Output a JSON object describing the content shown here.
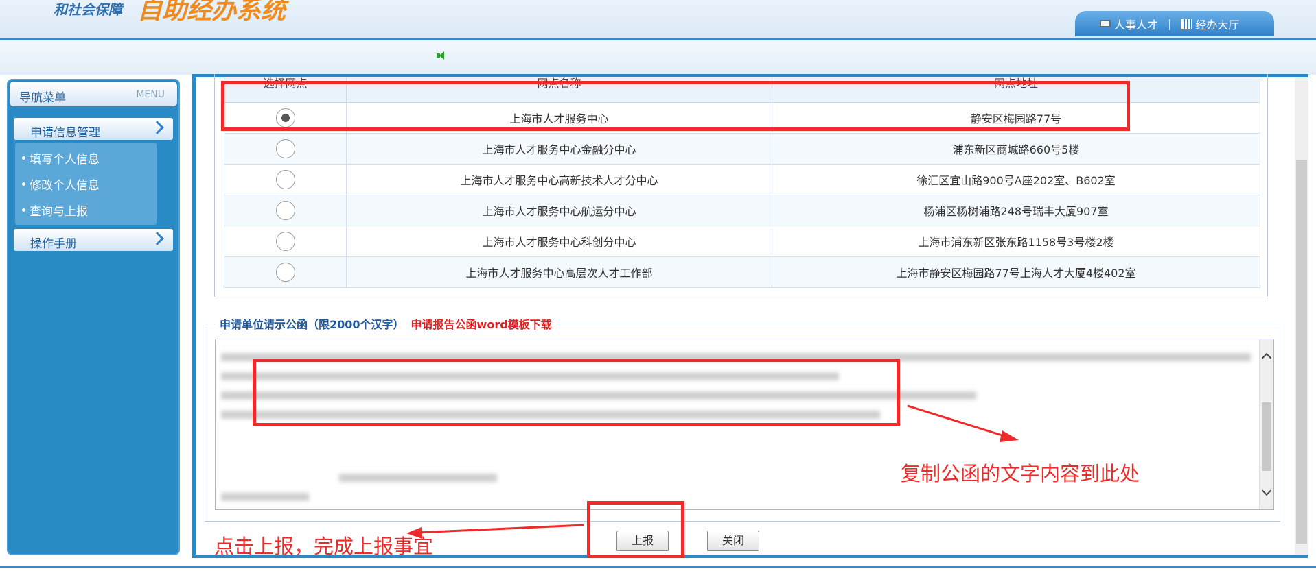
{
  "header": {
    "logo_sub": "和社会保障",
    "logo_main": "自助经办系统",
    "tabs": [
      {
        "label": "人事人才",
        "icon": "monitor-icon"
      },
      {
        "label": "经办大厅",
        "icon": "building-icon"
      }
    ],
    "tab_separator": "|"
  },
  "sidebar": {
    "title": "导航菜单",
    "title_en": "MENU",
    "groups": [
      {
        "label": "申请信息管理"
      },
      {
        "label": "操作手册"
      }
    ],
    "items": [
      {
        "label": "填写个人信息"
      },
      {
        "label": "修改个人信息"
      },
      {
        "label": "查询与上报"
      }
    ]
  },
  "table": {
    "headers": [
      "选择网点",
      "网点名称",
      "网点地址"
    ],
    "rows": [
      {
        "selected": true,
        "name": "上海市人才服务中心",
        "address": "静安区梅园路77号"
      },
      {
        "selected": false,
        "name": "上海市人才服务中心金融分中心",
        "address": "浦东新区商城路660号5楼"
      },
      {
        "selected": false,
        "name": "上海市人才服务中心高新技术人才分中心",
        "address": "徐汇区宜山路900号A座202室、B602室"
      },
      {
        "selected": false,
        "name": "上海市人才服务中心航运分中心",
        "address": "杨浦区杨树浦路248号瑞丰大厦907室"
      },
      {
        "selected": false,
        "name": "上海市人才服务中心科创分中心",
        "address": "上海市浦东新区张东路1158号3号楼2楼"
      },
      {
        "selected": false,
        "name": "上海市人才服务中心高层次人才工作部",
        "address": "上海市静安区梅园路77号上海人才大厦4楼402室"
      }
    ]
  },
  "letter": {
    "legend": "申请单位请示公函（限2000个汉字）",
    "download_link": "申请报告公函word模板下载"
  },
  "buttons": {
    "submit": "上报",
    "close": "关闭"
  },
  "annotations": {
    "copy_hint": "复制公函的文字内容到此处",
    "submit_hint": "点击上报，完成上报事宜",
    "color": "#ee2a2a"
  }
}
